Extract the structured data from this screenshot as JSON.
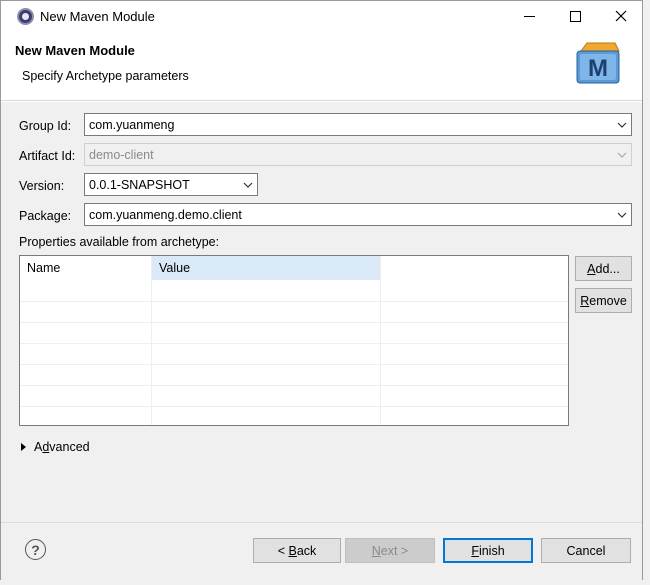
{
  "window": {
    "title": "New Maven Module"
  },
  "header": {
    "title": "New Maven Module",
    "subtitle": "Specify Archetype parameters",
    "logo_letter": "M"
  },
  "form": {
    "group_id_label": "Group Id:",
    "group_id_value": "com.yuanmeng",
    "artifact_id_label": "Artifact Id:",
    "artifact_id_value": "demo-client",
    "version_label": "Version:",
    "version_value": "0.0.1-SNAPSHOT",
    "package_label": "Package:",
    "package_value": "com.yuanmeng.demo.client",
    "properties_label": "Properties available from archetype:"
  },
  "table": {
    "columns": [
      "Name",
      "Value"
    ]
  },
  "side_buttons": {
    "add_prefix": "",
    "add_mnemonic": "A",
    "add_rest": "dd...",
    "remove_prefix": "",
    "remove_mnemonic": "R",
    "remove_rest": "emove"
  },
  "advanced": {
    "prefix": "A",
    "mnemonic": "d",
    "rest": "vanced"
  },
  "footer": {
    "help_symbol": "?",
    "back_prefix": "< ",
    "back_mnemonic": "B",
    "back_rest": "ack",
    "next_mnemonic": "N",
    "next_rest": "ext >",
    "finish_mnemonic": "F",
    "finish_rest": "inish",
    "cancel_label": "Cancel"
  },
  "colors": {
    "accent": "#0078d7",
    "selected_column": "#d9e9f8",
    "dialog_bg": "#f0f0f0"
  },
  "icons": [
    "app-icon",
    "minimize-icon",
    "maximize-icon",
    "close-icon",
    "maven-logo-icon",
    "chevron-down-icon",
    "expand-triangle-icon",
    "help-icon"
  ]
}
